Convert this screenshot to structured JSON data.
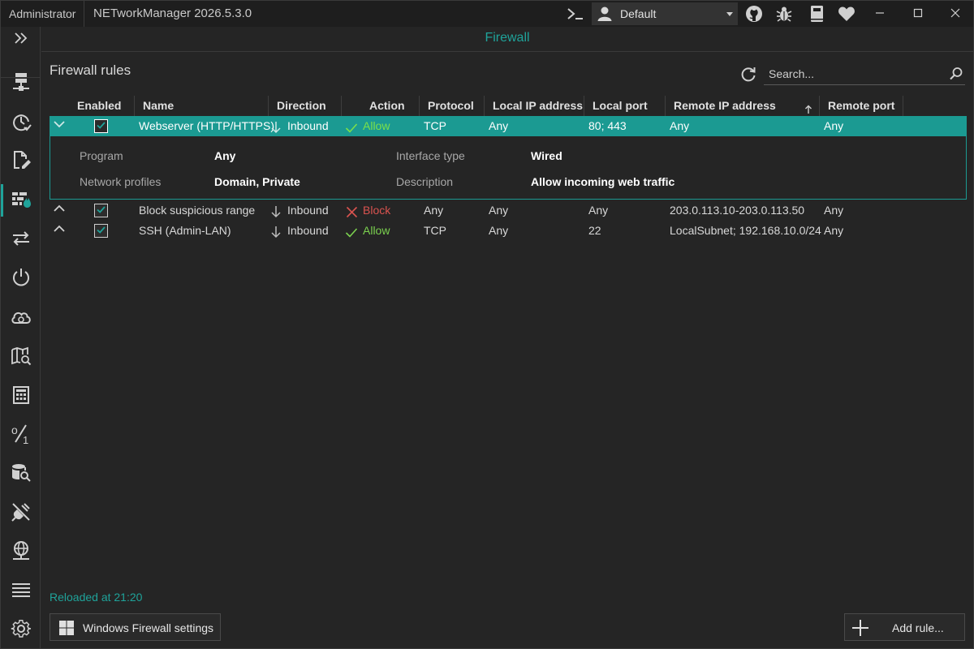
{
  "titlebar": {
    "user": "Administrator",
    "app_title": "NETworkManager 2026.5.3.0",
    "profile": "Default",
    "icons": [
      "terminal-icon",
      "user-icon",
      "github-icon",
      "bug-icon",
      "book-icon",
      "heart-icon",
      "minimize-icon",
      "maximize-icon",
      "close-icon"
    ]
  },
  "sidebar": {
    "items": [
      {
        "icon": "expand-icon"
      },
      {
        "icon": "server-icon"
      },
      {
        "icon": "history-icon"
      },
      {
        "icon": "edit-file-icon"
      },
      {
        "icon": "firewall-icon",
        "active": true
      },
      {
        "icon": "transfer-arrows-icon"
      },
      {
        "icon": "power-icon"
      },
      {
        "icon": "cloud-icon"
      },
      {
        "icon": "map-search-icon"
      },
      {
        "icon": "calculator-icon"
      },
      {
        "icon": "percent-icon"
      },
      {
        "icon": "database-search-icon"
      },
      {
        "icon": "disconnect-icon"
      },
      {
        "icon": "globe-network-icon"
      },
      {
        "icon": "list-icon"
      },
      {
        "icon": "settings-icon"
      }
    ]
  },
  "page": {
    "title": "Firewall",
    "section_title": "Firewall rules",
    "search_placeholder": "Search..."
  },
  "grid": {
    "columns": [
      "Enabled",
      "Name",
      "Direction",
      "Action",
      "Protocol",
      "Local IP address",
      "Local port",
      "Remote IP address",
      "Remote port"
    ],
    "sorted_column": "Remote IP address",
    "rows": [
      {
        "expanded": true,
        "enabled": true,
        "name": "Webserver (HTTP/HTTPS)",
        "direction": "Inbound",
        "action": "Allow",
        "protocol": "TCP",
        "local_ip": "Any",
        "local_port": "80; 443",
        "remote_ip": "Any",
        "remote_port": "Any"
      },
      {
        "expanded": false,
        "enabled": true,
        "name": "Block suspicious range",
        "direction": "Inbound",
        "action": "Block",
        "protocol": "Any",
        "local_ip": "Any",
        "local_port": "Any",
        "remote_ip": "203.0.113.10-203.0.113.50",
        "remote_port": "Any"
      },
      {
        "expanded": false,
        "enabled": true,
        "name": "SSH (Admin-LAN)",
        "direction": "Inbound",
        "action": "Allow",
        "protocol": "TCP",
        "local_ip": "Any",
        "local_port": "22",
        "remote_ip": "LocalSubnet; 192.168.10.0/24",
        "remote_port": "Any"
      }
    ],
    "details": {
      "program_label": "Program",
      "program": "Any",
      "profiles_label": "Network profiles",
      "profiles": "Domain, Private",
      "interface_label": "Interface type",
      "interface": "Wired",
      "description_label": "Description",
      "description": "Allow incoming web traffic"
    }
  },
  "footer": {
    "status": "Reloaded at 21:20",
    "windows_settings_label": "Windows Firewall settings",
    "add_rule_label": "Add rule..."
  },
  "colors": {
    "accent": "#1fa39a",
    "allow": "#7bd14f",
    "block": "#d9534f"
  }
}
